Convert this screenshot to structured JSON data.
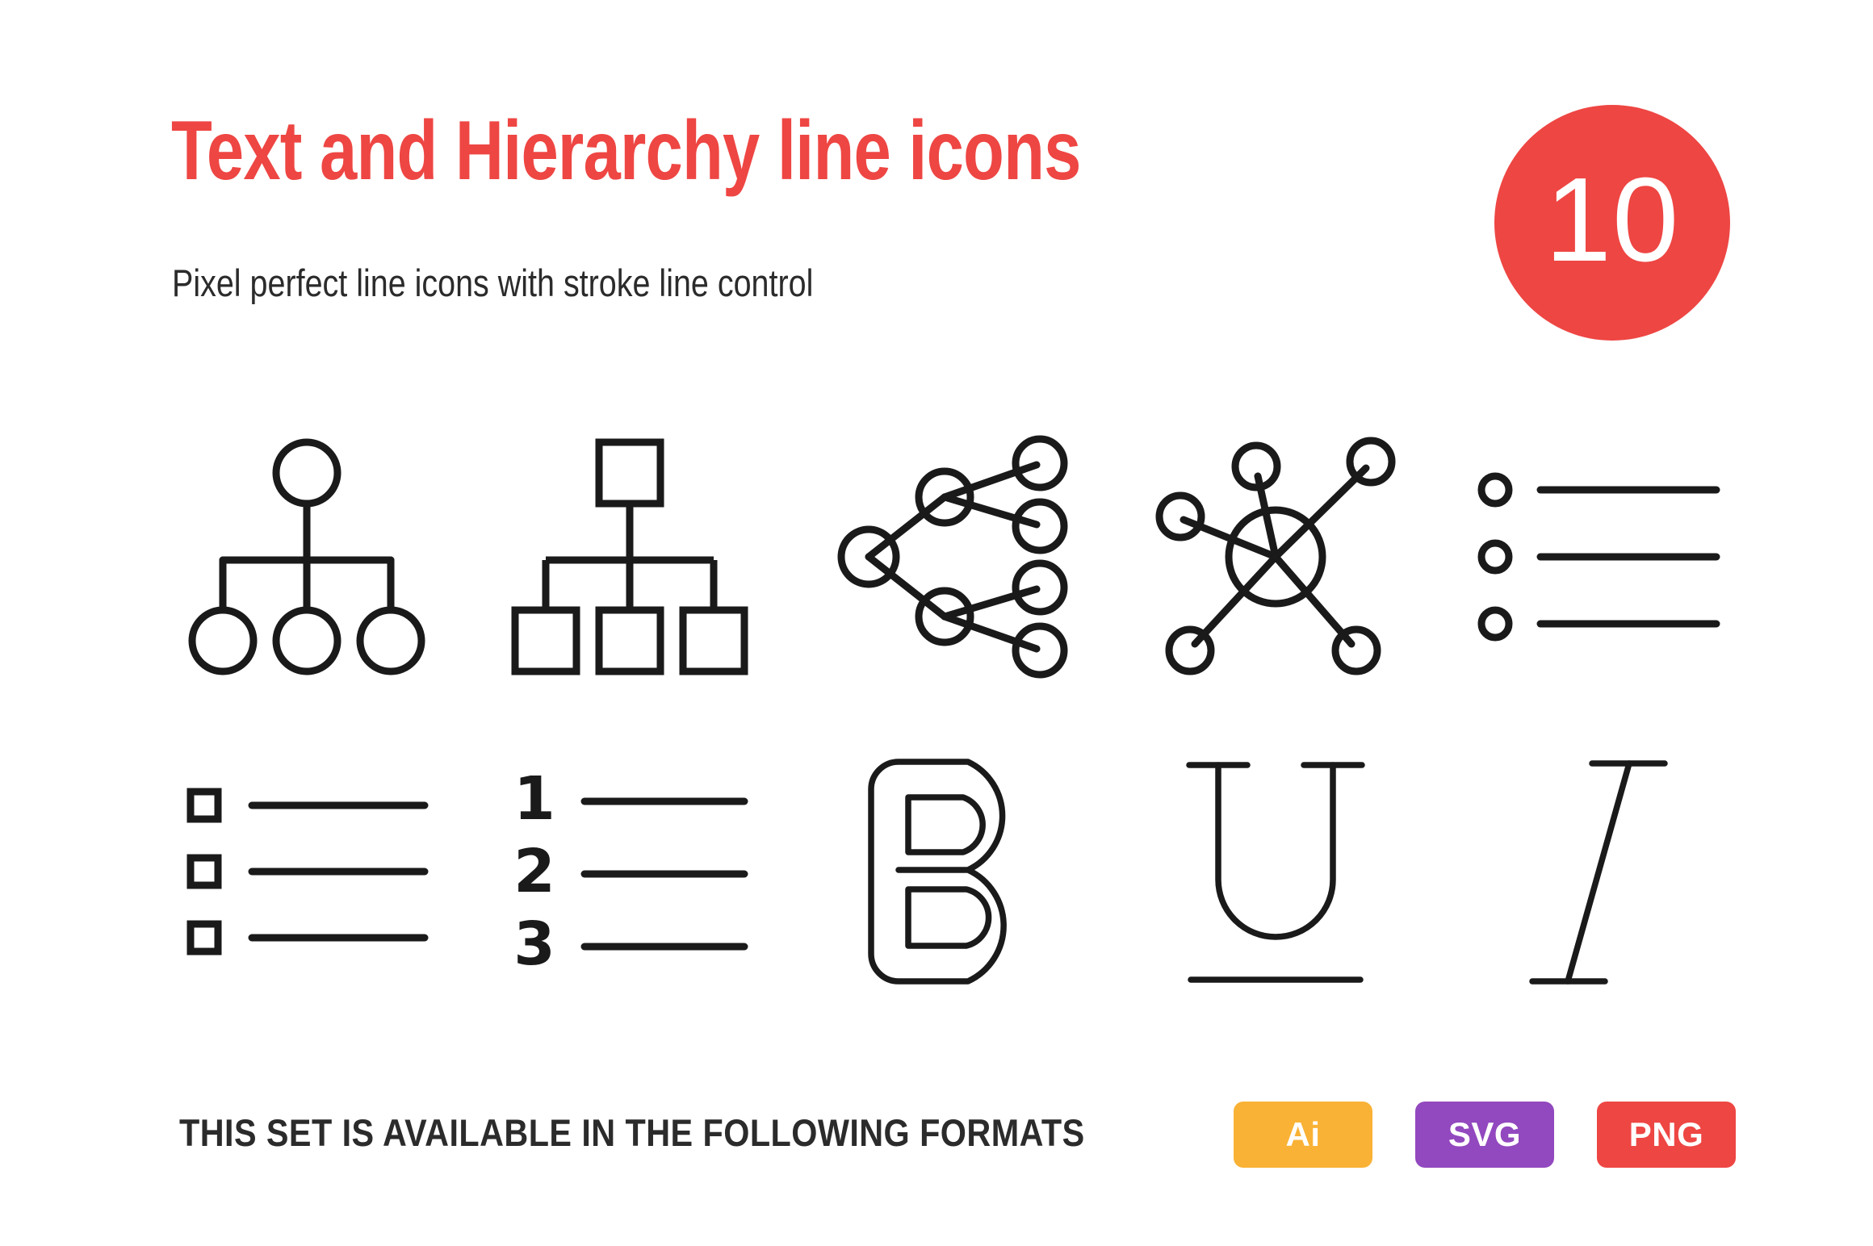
{
  "header": {
    "title": "Text and Hierarchy line icons",
    "subtitle": "Pixel perfect line icons with stroke line control",
    "count_badge": "10",
    "accent_color": "#EE4643",
    "text_color": "#2B2B2B"
  },
  "icons": {
    "stroke_color": "#1A1A1A",
    "items": [
      {
        "name": "org-chart-circles-icon",
        "label": "Organization chart with circle nodes",
        "row": 1,
        "position": 1
      },
      {
        "name": "org-chart-squares-icon",
        "label": "Organization chart with square nodes",
        "row": 1,
        "position": 2
      },
      {
        "name": "binary-tree-icon",
        "label": "Branching hierarchy tree",
        "row": 1,
        "position": 3
      },
      {
        "name": "hub-network-icon",
        "label": "Hub and spoke network",
        "row": 1,
        "position": 4
      },
      {
        "name": "bulleted-list-icon",
        "label": "Bulleted list with circle markers",
        "row": 1,
        "position": 5
      },
      {
        "name": "checkbox-list-icon",
        "label": "List with square checkbox markers",
        "row": 2,
        "position": 1
      },
      {
        "name": "numbered-list-icon",
        "label": "Numbered list",
        "row": 2,
        "position": 2,
        "numerals": [
          "1",
          "2",
          "3"
        ]
      },
      {
        "name": "bold-text-icon",
        "label": "Bold letter B",
        "row": 2,
        "position": 3,
        "glyph": "B"
      },
      {
        "name": "underline-text-icon",
        "label": "Underlined letter U",
        "row": 2,
        "position": 4,
        "glyph": "U"
      },
      {
        "name": "italic-text-icon",
        "label": "Italic letter I",
        "row": 2,
        "position": 5,
        "glyph": "I"
      }
    ]
  },
  "footer": {
    "note": "THIS SET IS AVAILABLE IN THE FOLLOWING FORMATS",
    "formats": [
      {
        "label": "Ai",
        "color": "#F9B235"
      },
      {
        "label": "SVG",
        "color": "#9248BE"
      },
      {
        "label": "PNG",
        "color": "#EE4643"
      }
    ]
  }
}
